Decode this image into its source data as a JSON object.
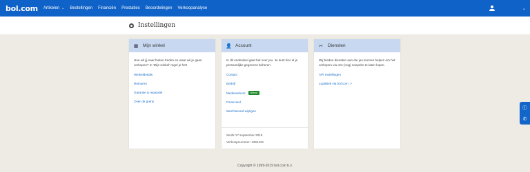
{
  "header": {
    "logo": "bol.com",
    "nav": [
      {
        "label": "Artikelen",
        "caret": "⌄"
      },
      {
        "label": "Bestellingen"
      },
      {
        "label": "Financiën"
      },
      {
        "label": "Prestaties"
      },
      {
        "label": "Beoordelingen"
      },
      {
        "label": "Verkoopanalyse"
      }
    ],
    "user_caret": "⌄"
  },
  "page": {
    "title": "Instellingen"
  },
  "cards": {
    "mijn_winkel": {
      "title": "Mijn winkel",
      "intro": "Hoe wil jij naar buiten treden en waar wil je gaan verkopen? In 'Mijn winkel' regel je het!",
      "links": [
        "Winkeldetails",
        "Retouren",
        "Garantie & reparatie",
        "Over de grens"
      ]
    },
    "account": {
      "title": "Account",
      "intro": "In dit onderdeel gaat het over jou. Je kunt hier al je persoonlijke gegevens beheren.",
      "links": [
        "Contact",
        "Bedrijf",
        "Medewerkers",
        "Financieel",
        "Wachtwoord wijzigen"
      ],
      "badge": "Nieuw",
      "since": "Sinds 17 september 2019",
      "seller_number": "Verkoopnummer: 1391431"
    },
    "diensten": {
      "title": "Diensten",
      "intro": "Wij bieden diensten aan die jou kunnen helpen om het verkopen via ons (nog) soepeler te laten lopen.",
      "links": [
        "API Instellingen",
        "Logistiek via bol.com"
      ]
    }
  },
  "footer": {
    "copyright": "Copyright © 1999-2019 bol.com b.v."
  },
  "colors": {
    "topbar": "#0f62c8",
    "card_header": "#c8d8f1",
    "link": "#1a6fc9",
    "badge": "#1f8a2c"
  }
}
